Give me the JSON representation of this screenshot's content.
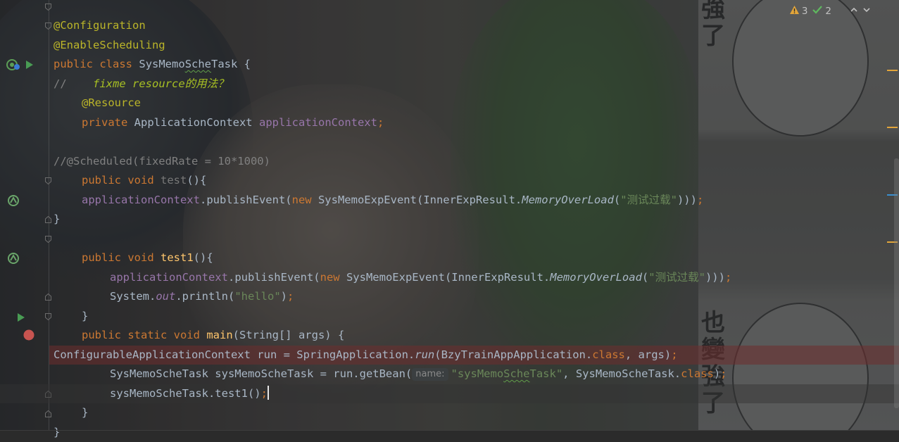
{
  "code": {
    "l1_ann": "@Configuration",
    "l2_ann": "@EnableScheduling",
    "l3_kw1": "public",
    "l3_kw2": "class",
    "l3_a": "SysMemo",
    "l3_b": "Sche",
    "l3_c": "Task {",
    "l4_cmt": "//    ",
    "l4_todo": "fixme resource的用法？",
    "l5_ann": "@Resource",
    "l6_kw": "private",
    "l6_type": "ApplicationContext",
    "l6_field": "applicationContext",
    "l6_semi": ";",
    "l8_cmt": "//@Scheduled(fixedRate = 10*1000)",
    "l9_kw": "public void",
    "l9_name": "test",
    "l9_rest": "(){",
    "l10_field": "applicationContext",
    "l10_a": ".publishEvent(",
    "l10_new": "new",
    "l10_b": " SysMemoExpEvent(InnerExpResult.",
    "l10_static": "MemoryOverLoad",
    "l10_c": "(",
    "l10_str": "\"测试过载\"",
    "l10_d": ")))",
    "l10_semi": ";",
    "l11": "}",
    "l13_kw": "public void",
    "l13_name": "test1",
    "l13_rest": "(){",
    "l14_field": "applicationContext",
    "l14_a": ".publishEvent(",
    "l14_new": "new",
    "l14_b": " SysMemoExpEvent(InnerExpResult.",
    "l14_static": "MemoryOverLoad",
    "l14_c": "(",
    "l14_str": "\"测试过载\"",
    "l14_d": ")))",
    "l14_semi": ";",
    "l15_a": "System.",
    "l15_out": "out",
    "l15_b": ".println(",
    "l15_str": "\"hello\"",
    "l15_c": ")",
    "l15_semi": ";",
    "l16": "}",
    "l17_kw": "public static void",
    "l17_name": "main",
    "l17_rest": "(String[] args) {",
    "l18_a": "ConfigurableApplicationContext run = SpringApplication.",
    "l18_run": "run",
    "l18_b": "(BzyTrainAppApplication.",
    "l18_class": "class",
    "l18_c": ", args)",
    "l18_semi": ";",
    "l19_a": "SysMemoScheTask sysMemoScheTask = run.getBean(",
    "l19_hint": "name:",
    "l19_str1": "\"sysMemo",
    "l19_str2": "Sche",
    "l19_str3": "Task\"",
    "l19_b": ", SysMemoScheTask.",
    "l19_class": "class",
    "l19_c": ")",
    "l19_semi": ";",
    "l20_a": "sysMemoScheTask.test1()",
    "l20_semi": ";",
    "l21": "}",
    "l22": "}"
  },
  "inspections": {
    "warnings": "3",
    "weak_warnings": "2",
    "warning_icon": "warning-triangle-icon",
    "ok_icon": "check-icon"
  },
  "wallpaper_text": {
    "top": "強了",
    "bottom": "也變強了"
  },
  "colors": {
    "keyword": "#cc7832",
    "annotation": "#bbb529",
    "field": "#9876aa",
    "string": "#6a8759",
    "method_decl": "#ffc66d",
    "comment": "#808080",
    "breakpoint": "#c75450",
    "run": "#499c54"
  }
}
